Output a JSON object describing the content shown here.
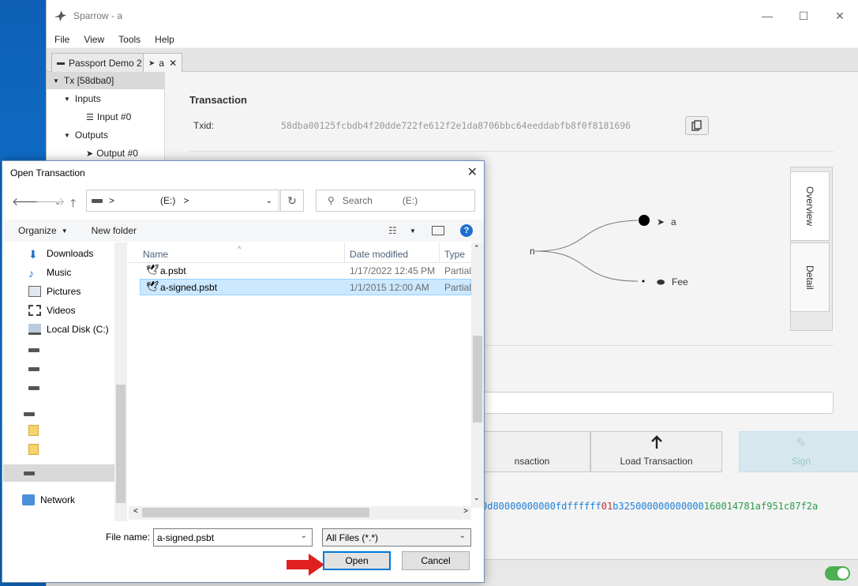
{
  "main": {
    "title": "Sparrow - a",
    "menu": [
      "File",
      "View",
      "Tools",
      "Help"
    ],
    "tabs": [
      {
        "label": "Passport Demo 2"
      },
      {
        "label": "a"
      }
    ],
    "tree": {
      "tx": "Tx [58dba0]",
      "inputs": "Inputs",
      "input0": "Input #0",
      "outputs": "Outputs",
      "output0": "Output #0"
    },
    "section_title": "Transaction",
    "txid_label": "Txid:",
    "txid": "58dba00125fcbdb4f20dde722fe612f2e1da8706bbc64eeddabfb8f0f8181696",
    "side_tabs": [
      "Overview",
      "Detail"
    ],
    "diagram": {
      "input_partial": "n",
      "output_label": "a",
      "fee_label": "Fee"
    },
    "buttons": {
      "save_partial": "nsaction",
      "load": "Load Transaction",
      "sign": "Sign"
    },
    "hex": {
      "part1": "0d80000000000",
      "part2": "fdffffff",
      "part3": "01",
      "part4": "b325000000000000",
      "part5": "160014781af951c87f2a"
    }
  },
  "dialog": {
    "title": "Open Transaction",
    "address_sep": ">",
    "address_drive": "(E:)",
    "search_placeholder": "Search",
    "search_drive": "(E:)",
    "organize": "Organize",
    "new_folder": "New folder",
    "nav_items": {
      "downloads": "Downloads",
      "music": "Music",
      "pictures": "Pictures",
      "videos": "Videos",
      "local_disk": "Local Disk (C:)",
      "network": "Network"
    },
    "columns": {
      "name": "Name",
      "date": "Date modified",
      "type": "Type"
    },
    "files": [
      {
        "name": "a.psbt",
        "date": "1/17/2022 12:45 PM",
        "type": "Partial"
      },
      {
        "name": "a-signed.psbt",
        "date": "1/1/2015 12:00 AM",
        "type": "Partial"
      }
    ],
    "filename_label": "File name:",
    "filename_value": "a-signed.psbt",
    "filter": "All Files (*.*)",
    "open_label": "Open",
    "cancel_label": "Cancel"
  },
  "colors": {
    "accent": "#0078d7",
    "selection": "#cce8ff",
    "arrow": "#e02020",
    "toggle": "#4caf50"
  }
}
